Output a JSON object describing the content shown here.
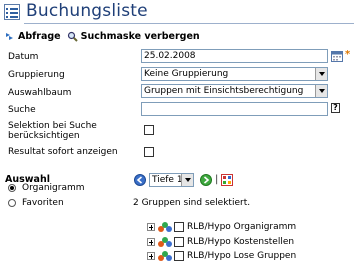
{
  "header": {
    "title": "Buchungsliste"
  },
  "toolbar": {
    "query_label": "Abfrage",
    "hide_search_label": "Suchmaske verbergen"
  },
  "form": {
    "datum": {
      "label": "Datum",
      "value": "25.02.2008"
    },
    "gruppierung": {
      "label": "Gruppierung",
      "value": "Keine Gruppierung"
    },
    "auswahlbaum": {
      "label": "Auswahlbaum",
      "value": "Gruppen mit Einsichtsberechtigung"
    },
    "suche": {
      "label": "Suche",
      "value": "",
      "help": "?"
    },
    "selektion": {
      "label_line1": "Selektion bei Suche",
      "label_line2": "berücksichtigen"
    },
    "resultat": {
      "label": "Resultat sofort anzeigen"
    }
  },
  "auswahl": {
    "title": "Auswahl",
    "options": [
      "Organigramm",
      "Favoriten"
    ],
    "depth_value": "Tiefe 1",
    "depth_sep": "|",
    "status": "2 Gruppen sind selektiert.",
    "groups": [
      "RLB/Hypo Organigramm",
      "RLB/Hypo Kostenstellen",
      "RLB/Hypo Lose Gruppen"
    ]
  },
  "colors": {
    "title": "#1f3f78",
    "required_marker": "#e07800",
    "input_border": "#7f9db9"
  }
}
